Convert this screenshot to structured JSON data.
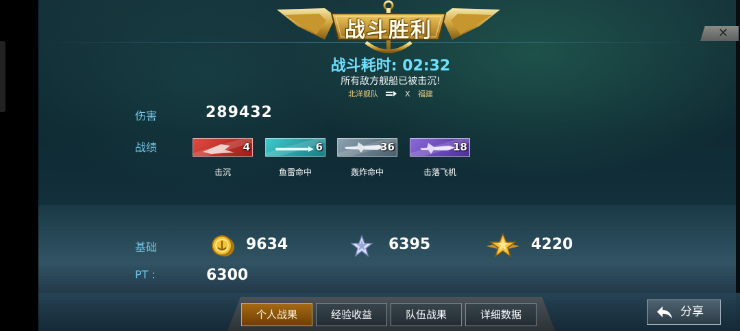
{
  "header": {
    "title": "战斗胜利",
    "duration_label": "战斗耗时: 02:32",
    "subtitle": "所有敌方舰船已被击沉!",
    "fleet": {
      "ally": "北洋舰队",
      "versus": "X",
      "enemy": "福建"
    }
  },
  "stats": {
    "damage_label": "伤害",
    "damage_value": "289432",
    "record_label": "战绩",
    "medals": [
      {
        "name": "击沉",
        "count": "4",
        "color": "#c8302a"
      },
      {
        "name": "鱼雷命中",
        "count": "6",
        "color": "#24a7b2"
      },
      {
        "name": "轰炸命中",
        "count": "36",
        "color": "#6a8090"
      },
      {
        "name": "击落飞机",
        "count": "18",
        "color": "#6a4ab4"
      }
    ]
  },
  "rewards": {
    "base_label": "基础",
    "gold_icon": "gold-coin-icon",
    "gold": "9634",
    "silver_icon": "silver-star-icon",
    "silver_star": "6395",
    "gold_star_icon": "gold-star-icon",
    "gold_star": "4220",
    "pt_label": "PT :",
    "pt_value": "6300"
  },
  "tabs": [
    {
      "label": "个人战果",
      "active": true
    },
    {
      "label": "经验收益",
      "active": false
    },
    {
      "label": "队伍战果",
      "active": false
    },
    {
      "label": "详细数据",
      "active": false
    }
  ],
  "share_label": "分享",
  "colors": {
    "accent_cyan": "#6ee0ff",
    "label_blue": "#72c8ea",
    "gold": "#e8b32a"
  }
}
